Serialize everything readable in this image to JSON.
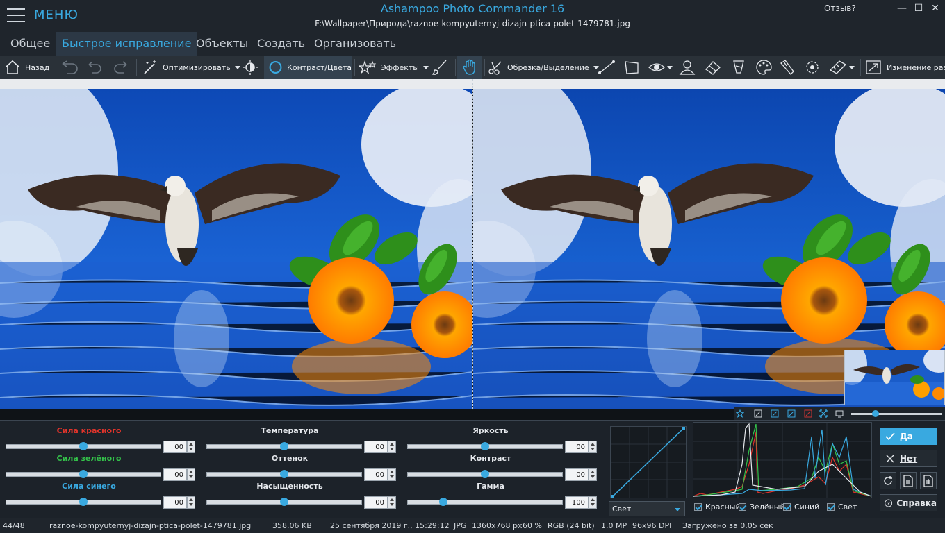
{
  "app": {
    "menu_label": "МЕНЮ",
    "title": "Ashampoo Photo Commander 16",
    "file_path": "F:\\Wallpaper\\Природа\\raznoe-kompyuternyj-dizajn-ptica-polet-1479781.jpg",
    "feedback": "Отзыв?"
  },
  "tabs": [
    "Общее",
    "Быстрое исправление",
    "Объекты",
    "Создать",
    "Организовать"
  ],
  "active_tab": "Быстрое исправление",
  "toolbar": {
    "back": "Назад",
    "optimize": "Оптимизировать",
    "contrast_colors": "Контраст/Цвета",
    "effects": "Эффекты",
    "crop_select": "Обрезка/Выделение",
    "resize": "Изменение раз"
  },
  "sliders": [
    {
      "label": "Сила красного",
      "value": "00",
      "level": 0.5,
      "color": "#e0342b"
    },
    {
      "label": "Сила зелёного",
      "value": "00",
      "level": 0.5,
      "color": "#34c24a"
    },
    {
      "label": "Сила синего",
      "value": "00",
      "level": 0.5,
      "color": "#39a9e0"
    },
    {
      "label": "Температура",
      "value": "00",
      "level": 0.5
    },
    {
      "label": "Оттенок",
      "value": "00",
      "level": 0.5
    },
    {
      "label": "Насыщенность",
      "value": "00",
      "level": 0.5
    },
    {
      "label": "Яркость",
      "value": "00",
      "level": 0.5
    },
    {
      "label": "Контраст",
      "value": "00",
      "level": 0.5
    },
    {
      "label": "Гамма",
      "value": "100",
      "level": 0.23
    }
  ],
  "curve": {
    "channel": "Свет"
  },
  "histogram": {
    "channels": [
      "Красный",
      "Зелёный",
      "Синий",
      "Свет"
    ]
  },
  "actions": {
    "yes": "Да",
    "no": "Нет",
    "help": "Справка"
  },
  "status": {
    "index": "44/48",
    "filename": "raznoe-kompyuternyj-dizajn-ptica-polet-1479781.jpg",
    "size": "358.06 KB",
    "date": "25 сентября 2019 г., 15:29:12",
    "format": "JPG",
    "dimensions": "1360x768 px",
    "zoom": "60 %",
    "color_mode": "RGB (24 bit)",
    "megapixels": "1.0 MP",
    "dpi": "96x96 DPI",
    "load_time": "Загружено за 0.05 сек"
  },
  "colors": {
    "accent": "#39a9e0",
    "background": "#1b2128"
  }
}
